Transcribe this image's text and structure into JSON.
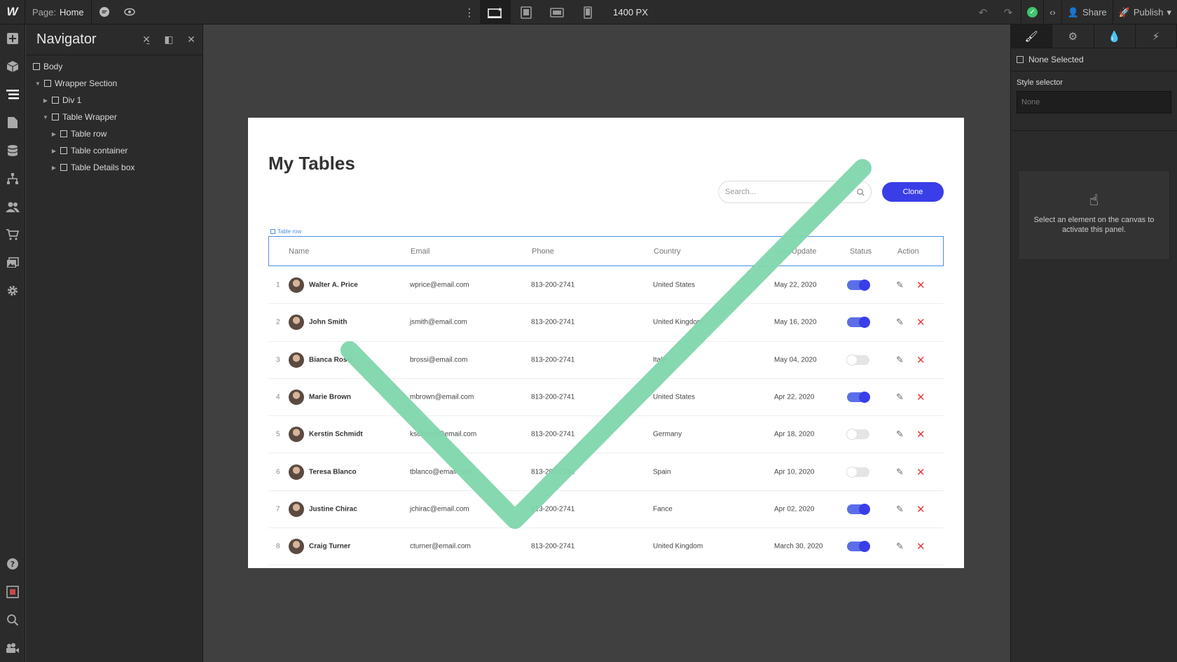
{
  "topbar": {
    "logo": "W",
    "page_label": "Page:",
    "page_value": "Home",
    "width_value": "1400 PX",
    "share_label": "Share",
    "publish_label": "Publish"
  },
  "navigator": {
    "title": "Navigator",
    "nodes": [
      {
        "label": "Body"
      },
      {
        "label": "Wrapper Section"
      },
      {
        "label": "Div 1"
      },
      {
        "label": "Table Wrapper"
      },
      {
        "label": "Table row"
      },
      {
        "label": "Table container"
      },
      {
        "label": "Table Details box"
      }
    ]
  },
  "canvas": {
    "title": "My Tables",
    "search_placeholder": "Search...",
    "clone_label": "Clone",
    "selected_label": "Table row",
    "headers": {
      "name": "Name",
      "email": "Email",
      "phone": "Phone",
      "country": "Country",
      "update": "Last Update",
      "status": "Status",
      "action": "Action"
    },
    "rows": [
      {
        "num": "1",
        "name": "Walter A. Price",
        "email": "wprice@email.com",
        "phone": "813-200-2741",
        "country": "United States",
        "update": "May 22, 2020",
        "status": "on"
      },
      {
        "num": "2",
        "name": "John Smith",
        "email": "jsmith@email.com",
        "phone": "813-200-2741",
        "country": "United Kingdom",
        "update": "May 16, 2020",
        "status": "on"
      },
      {
        "num": "3",
        "name": "Bianca Rossi",
        "email": "brossi@email.com",
        "phone": "813-200-2741",
        "country": "Italy",
        "update": "May 04, 2020",
        "status": "off"
      },
      {
        "num": "4",
        "name": "Marie Brown",
        "email": "mbrown@email.com",
        "phone": "813-200-2741",
        "country": "United States",
        "update": "Apr 22, 2020",
        "status": "on"
      },
      {
        "num": "5",
        "name": "Kerstin Schmidt",
        "email": "kschmidt@email.com",
        "phone": "813-200-2741",
        "country": "Germany",
        "update": "Apr 18, 2020",
        "status": "off"
      },
      {
        "num": "6",
        "name": "Teresa Blanco",
        "email": "tblanco@email.com",
        "phone": "813-200-2741",
        "country": "Spain",
        "update": "Apr 10, 2020",
        "status": "off"
      },
      {
        "num": "7",
        "name": "Justine Chirac",
        "email": "jchirac@email.com",
        "phone": "813-200-2741",
        "country": "Fance",
        "update": "Apr 02, 2020",
        "status": "on"
      },
      {
        "num": "8",
        "name": "Craig Turner",
        "email": "cturner@email.com",
        "phone": "813-200-2741",
        "country": "United Kingdom",
        "update": "March 30, 2020",
        "status": "on"
      }
    ]
  },
  "rightpanel": {
    "none_selected": "None Selected",
    "style_selector_label": "Style selector",
    "style_selector_placeholder": "None",
    "empty_message": "Select an element on the canvas to activate this panel."
  },
  "colors": {
    "accent": "#3a3ee8",
    "delete": "#e53935",
    "check_overlay": "#7fd6ad",
    "publish_ok": "#3ec46d"
  }
}
